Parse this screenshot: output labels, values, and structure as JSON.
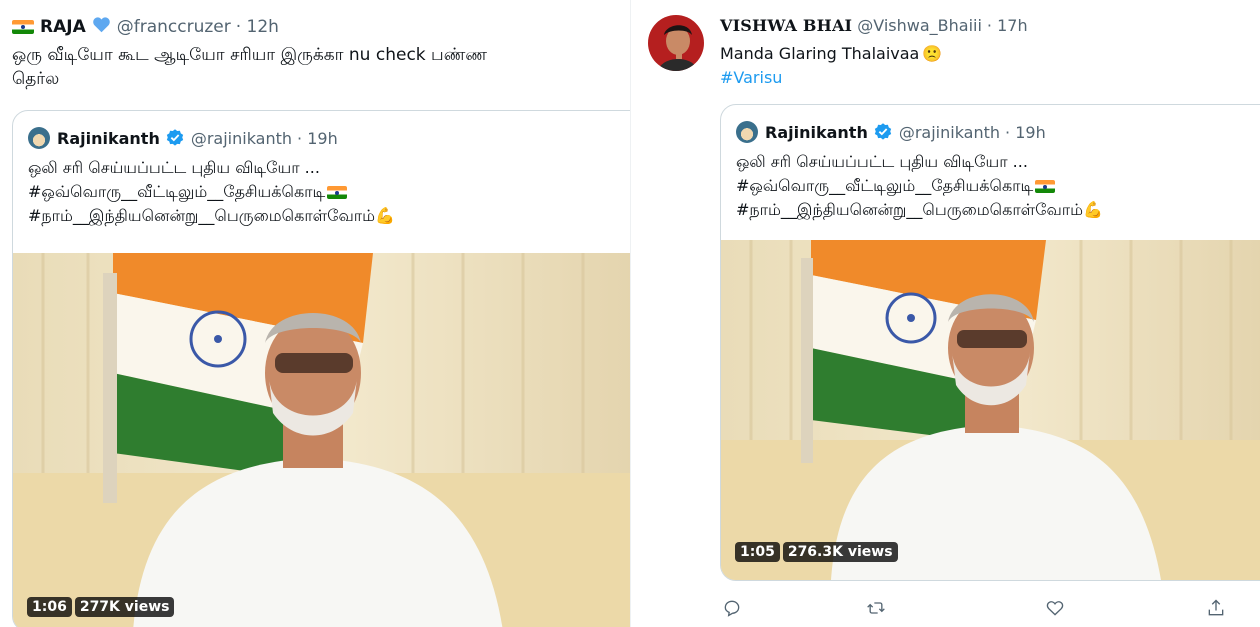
{
  "left_tweet": {
    "author_name": "RAJA",
    "author_handle": "@franccruzer",
    "timestamp": "· 12h",
    "text_line1": "ஒரு வீடியோ கூட  ஆடியோ சரியா இருக்கா nu check பண்ண",
    "text_line2": "தெர்ல",
    "quoted": {
      "author_name": "Rajinikanth",
      "author_handle": "@rajinikanth",
      "timestamp": "· 19h",
      "line1": "ஒலி சரி செய்யப்பட்ட புதிய விடியோ ...",
      "line2": "#ஒவ்வொரு__வீட்டிலும்__தேசியக்கொடி",
      "line3": "#நாம்__இந்தியனென்று__பெருமைகொள்வோம்",
      "emoji_muscle": "💪",
      "video_duration": "1:06",
      "video_views": "277K views"
    }
  },
  "right_tweet": {
    "author_name": "VISHWA BHAI",
    "author_handle": "@Vishwa_Bhaiii",
    "timestamp": "· 17h",
    "text_line1": "Manda Glaring  Thalaivaa",
    "emoji_face": "🙁",
    "hashtag": "#Varisu",
    "quoted": {
      "author_name": "Rajinikanth",
      "author_handle": "@rajinikanth",
      "timestamp": "· 19h",
      "line1": "ஒலி சரி செய்யப்பட்ட புதிய விடியோ ...",
      "line2": "#ஒவ்வொரு__வீட்டிலும்__தேசியக்கொடி",
      "line3": "#நாம்__இந்தியனென்று__பெருமைகொள்வோம்",
      "emoji_muscle": "💪",
      "video_duration": "1:05",
      "video_views": "276.3K views"
    }
  },
  "icons": {
    "heart": "blue-heart-icon",
    "verified": "verified-badge-icon",
    "flag": "india-flag-icon",
    "actions": [
      "reply-icon",
      "retweet-icon",
      "like-icon",
      "share-icon"
    ]
  },
  "colors": {
    "link": "#1d9bf0",
    "muted": "#536471",
    "border": "#cfd9de"
  }
}
